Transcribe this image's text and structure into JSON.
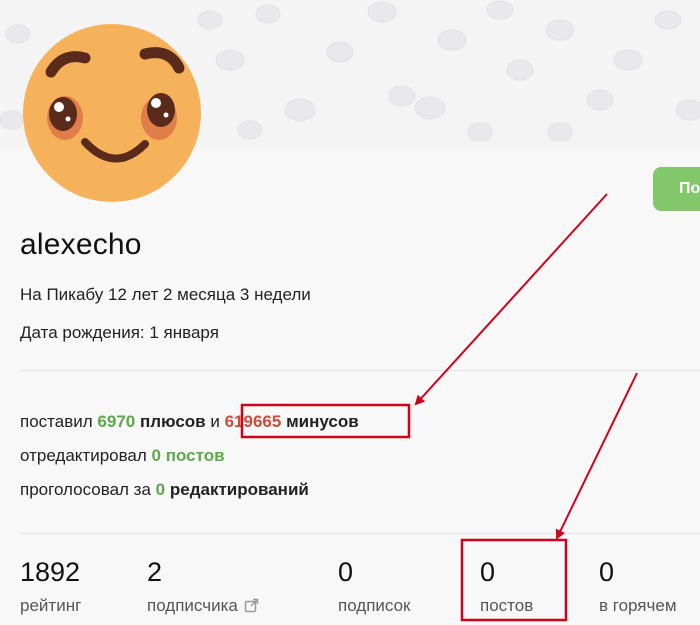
{
  "profile": {
    "username": "alexecho",
    "on_site": "На Пикабу 12 лет 2 месяца 3 недели",
    "birthday": "Дата рождения: 1 января",
    "subscribe_label": "По"
  },
  "activity": {
    "votes_prefix": "поставил",
    "pluses": "6970",
    "pluses_word": "плюсов",
    "and_word": "и",
    "minuses": "619665",
    "minuses_word": "минусов",
    "edited_prefix": "отредактировал",
    "edited_count": "0",
    "edited_word": "постов",
    "voted_prefix": "проголосовал за",
    "voted_count": "0",
    "voted_word": "редактирований"
  },
  "counters": [
    {
      "value": "1892",
      "label": "рейтинг"
    },
    {
      "value": "2",
      "label": "подписчика"
    },
    {
      "value": "0",
      "label": "подписок"
    },
    {
      "value": "0",
      "label": "постов"
    },
    {
      "value": "0",
      "label": "в горячем"
    }
  ],
  "colors": {
    "accent_green": "#82c86b",
    "plus_green": "#5da84a",
    "minus_red": "#cc4d3d",
    "annotation_red": "#d0021b"
  },
  "icons": {
    "avatar": "smiling-face",
    "external_link": "external-link-icon"
  }
}
